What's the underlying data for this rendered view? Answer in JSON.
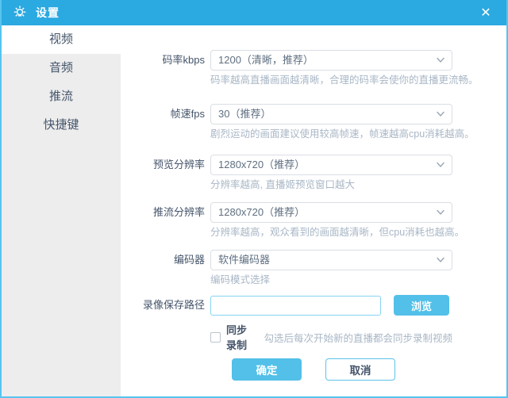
{
  "window": {
    "title": "设置",
    "close_glyph": "✕"
  },
  "sidebar": {
    "items": [
      {
        "label": "视频",
        "active": true
      },
      {
        "label": "音频",
        "active": false
      },
      {
        "label": "推流",
        "active": false
      },
      {
        "label": "快捷键",
        "active": false
      }
    ]
  },
  "form": {
    "rows": [
      {
        "label": "码率kbps",
        "value": "1200（清晰，推荐）",
        "hint": "码率越高直播画面越清晰，合理的码率会使你的直播更流畅。"
      },
      {
        "label": "帧速fps",
        "value": "30（推荐）",
        "hint": "剧烈运动的画面建议使用较高帧速，帧速越高cpu消耗越高。"
      },
      {
        "label": "预览分辨率",
        "value": "1280x720（推荐）",
        "hint": "分辨率越高, 直播姬预览窗口越大"
      },
      {
        "label": "推流分辨率",
        "value": "1280x720（推荐）",
        "hint": "分辨率越高，观众看到的画面越清晰，但cpu消耗也越高。"
      },
      {
        "label": "编码器",
        "value": "软件编码器",
        "hint": "编码模式选择"
      }
    ],
    "path_row": {
      "label": "录像保存路径",
      "input_value": "",
      "browse_label": "浏览"
    },
    "record_row": {
      "checkbox_label": "同步录制",
      "checked": false,
      "hint": "勾选后每次开始新的直播都会同步录制视频"
    }
  },
  "footer": {
    "ok_label": "确定",
    "cancel_label": "取消"
  },
  "colors": {
    "titlebar": "#2BA9E1",
    "accent": "#52C0E8",
    "accent_border": "#5BC4EA",
    "sidebar_bg": "#EDEDED",
    "text_dark": "#44546A",
    "hint": "#A9B7C6",
    "border": "#D9DEE4",
    "input_border": "#86D4F1",
    "window_border": "#57C5EF"
  }
}
